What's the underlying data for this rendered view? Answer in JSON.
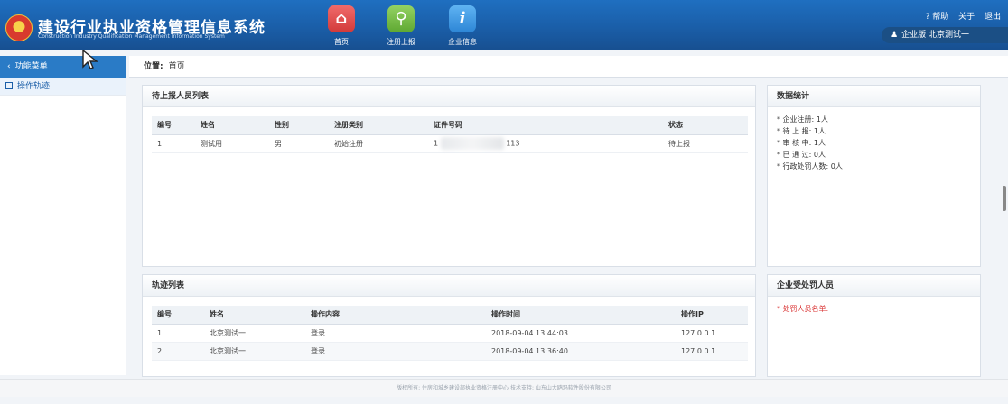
{
  "header": {
    "title": "建设行业执业资格管理信息系统",
    "subtitle": "Construction Industry Qualification Management Information System",
    "nav": [
      {
        "label": "首页",
        "icon": "home-icon"
      },
      {
        "label": "注册上报",
        "icon": "register-upload-icon"
      },
      {
        "label": "企业信息",
        "icon": "info-icon"
      }
    ],
    "links": {
      "help": "? 帮助",
      "about": "关于",
      "logout": "退出"
    },
    "user": "企业版 北京测试一"
  },
  "sidebar": {
    "header": "功能菜单",
    "items": [
      {
        "label": "操作轨迹"
      }
    ]
  },
  "breadcrumb": {
    "label": "位置:",
    "value": "首页"
  },
  "pending_panel": {
    "title": "待上报人员列表",
    "columns": [
      "编号",
      "姓名",
      "性别",
      "注册类别",
      "证件号码",
      "状态"
    ],
    "rows": [
      {
        "no": "1",
        "name": "测试用",
        "gender": "男",
        "category": "初始注册",
        "id_prefix": "1",
        "id_suffix": "113",
        "status": "待上报"
      }
    ]
  },
  "stats_panel": {
    "title": "数据统计",
    "lines": [
      "* 企业注册: 1人",
      "* 待 上 报: 1人",
      "* 审 核 中: 1人",
      "* 已 通 过: 0人",
      "* 行政处罚人数: 0人"
    ]
  },
  "track_panel": {
    "title": "轨迹列表",
    "columns": [
      "编号",
      "姓名",
      "操作内容",
      "操作时间",
      "操作IP"
    ],
    "rows": [
      {
        "no": "1",
        "name": "北京测试一",
        "action": "登录",
        "time": "2018-09-04 13:44:03",
        "ip": "127.0.0.1"
      },
      {
        "no": "2",
        "name": "北京测试一",
        "action": "登录",
        "time": "2018-09-04 13:36:40",
        "ip": "127.0.0.1"
      }
    ]
  },
  "penalty_panel": {
    "title": "企业受处罚人员",
    "note": "* 处罚人员名单:"
  },
  "footer": "版权所有: 住房和城乡建设部执业资格注册中心  技术支持: 山东山大鸥玛软件股份有限公司",
  "colors": {
    "header": "#1a5ea8",
    "accent": "#2a7bc6",
    "warning": "#d82c2c"
  }
}
